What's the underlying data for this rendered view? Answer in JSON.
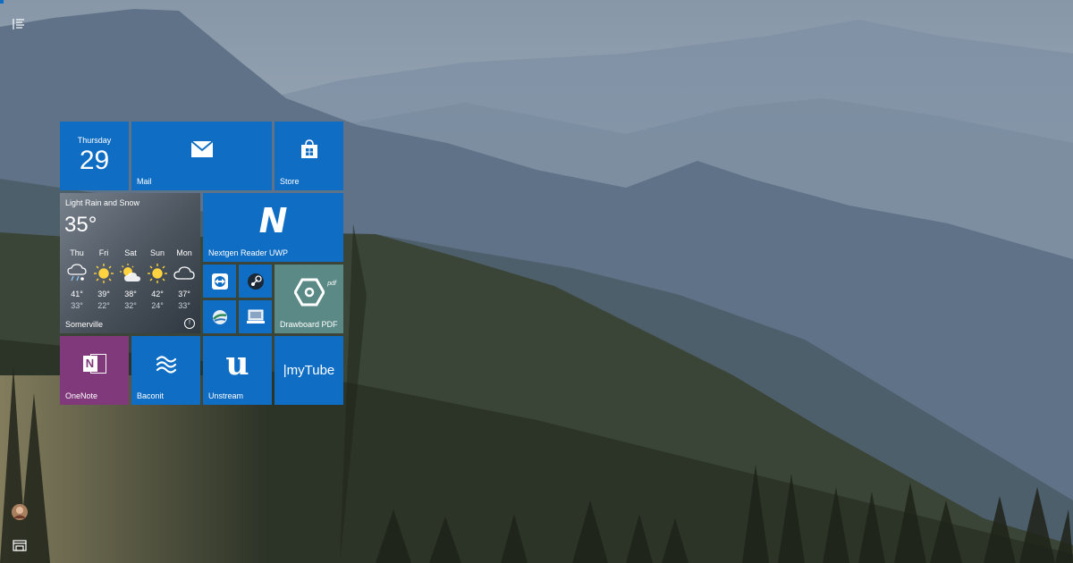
{
  "colors": {
    "tile_blue": "#0f6ec4",
    "onenote_purple": "#80397b",
    "drawboard_teal": "#5b8a86",
    "weather_bg": "#5a6470"
  },
  "rail": {
    "menu_icon": "hamburger-list-icon",
    "account_icon": "user-avatar",
    "explorer_icon": "file-explorer-icon"
  },
  "calendar": {
    "day": "Thursday",
    "date": "29"
  },
  "mail": {
    "label": "Mail",
    "icon": "envelope-icon"
  },
  "store": {
    "label": "Store",
    "icon": "shopping-bag-icon"
  },
  "weather": {
    "condition": "Light Rain and Snow",
    "temp": "35°",
    "location": "Somerville",
    "forecast": [
      {
        "day": "Thu",
        "icon": "rain-snow-icon",
        "hi": "41°",
        "lo": "33°"
      },
      {
        "day": "Fri",
        "icon": "sun-icon",
        "hi": "39°",
        "lo": "22°"
      },
      {
        "day": "Sat",
        "icon": "partly-sunny-icon",
        "hi": "38°",
        "lo": "32°"
      },
      {
        "day": "Sun",
        "icon": "sun-icon",
        "hi": "42°",
        "lo": "24°"
      },
      {
        "day": "Mon",
        "icon": "cloudy-icon",
        "hi": "37°",
        "lo": "33°"
      }
    ]
  },
  "nextgen": {
    "label": "Nextgen Reader UWP",
    "glyph": "N"
  },
  "drawboard": {
    "label": "Drawboard PDF",
    "glyph": "pdf"
  },
  "onenote": {
    "label": "OneNote",
    "glyph": "N"
  },
  "baconit": {
    "label": "Baconit"
  },
  "unstream": {
    "label": "Unstream",
    "glyph": "u"
  },
  "mytube": {
    "label": "|myTube"
  }
}
